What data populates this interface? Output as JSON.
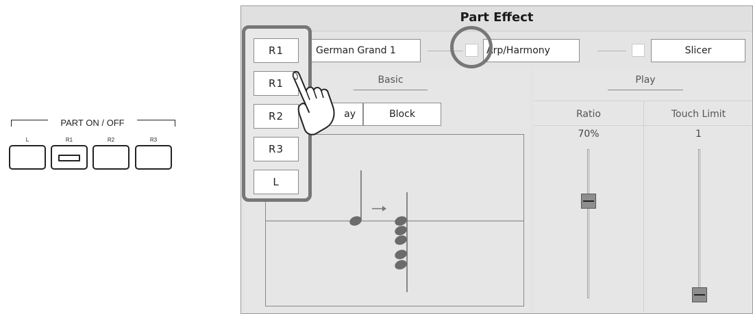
{
  "panel": {
    "title": "PART ON / OFF",
    "keys": [
      {
        "label": "L"
      },
      {
        "label": "R1"
      },
      {
        "label": "R2"
      },
      {
        "label": "R3"
      }
    ]
  },
  "screen": {
    "title": "Part Effect",
    "top_row": {
      "part": "R1",
      "voice": "German Grand 1",
      "arp_label": "Arp/Harmony",
      "slicer_label": "Slicer"
    },
    "part_options": [
      "R1",
      "R1",
      "R2",
      "R3",
      "L"
    ],
    "basic": {
      "heading": "Basic",
      "type_partial": "ay",
      "block_label": "Block"
    },
    "play": {
      "heading": "Play",
      "columns": [
        {
          "label": "Ratio",
          "value": "70%",
          "level": 0.7
        },
        {
          "label": "Touch Limit",
          "value": "1",
          "level": 0.0
        }
      ]
    }
  }
}
